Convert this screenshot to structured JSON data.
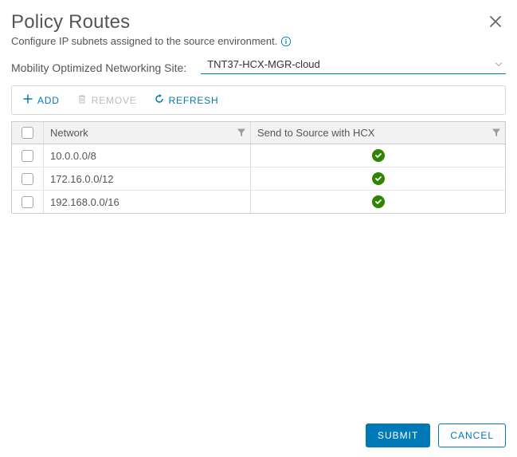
{
  "header": {
    "title": "Policy Routes",
    "subtitle": "Configure IP subnets assigned to the source environment."
  },
  "site": {
    "label": "Mobility Optimized Networking Site:",
    "selected": "TNT37-HCX-MGR-cloud"
  },
  "toolbar": {
    "add": "ADD",
    "remove": "REMOVE",
    "refresh": "REFRESH"
  },
  "table": {
    "headers": {
      "network": "Network",
      "hcx": "Send to Source with HCX"
    },
    "rows": [
      {
        "network": "10.0.0.0/8",
        "hcx": true
      },
      {
        "network": "172.16.0.0/12",
        "hcx": true
      },
      {
        "network": "192.168.0.0/16",
        "hcx": true
      }
    ]
  },
  "footer": {
    "submit": "SUBMIT",
    "cancel": "CANCEL"
  }
}
